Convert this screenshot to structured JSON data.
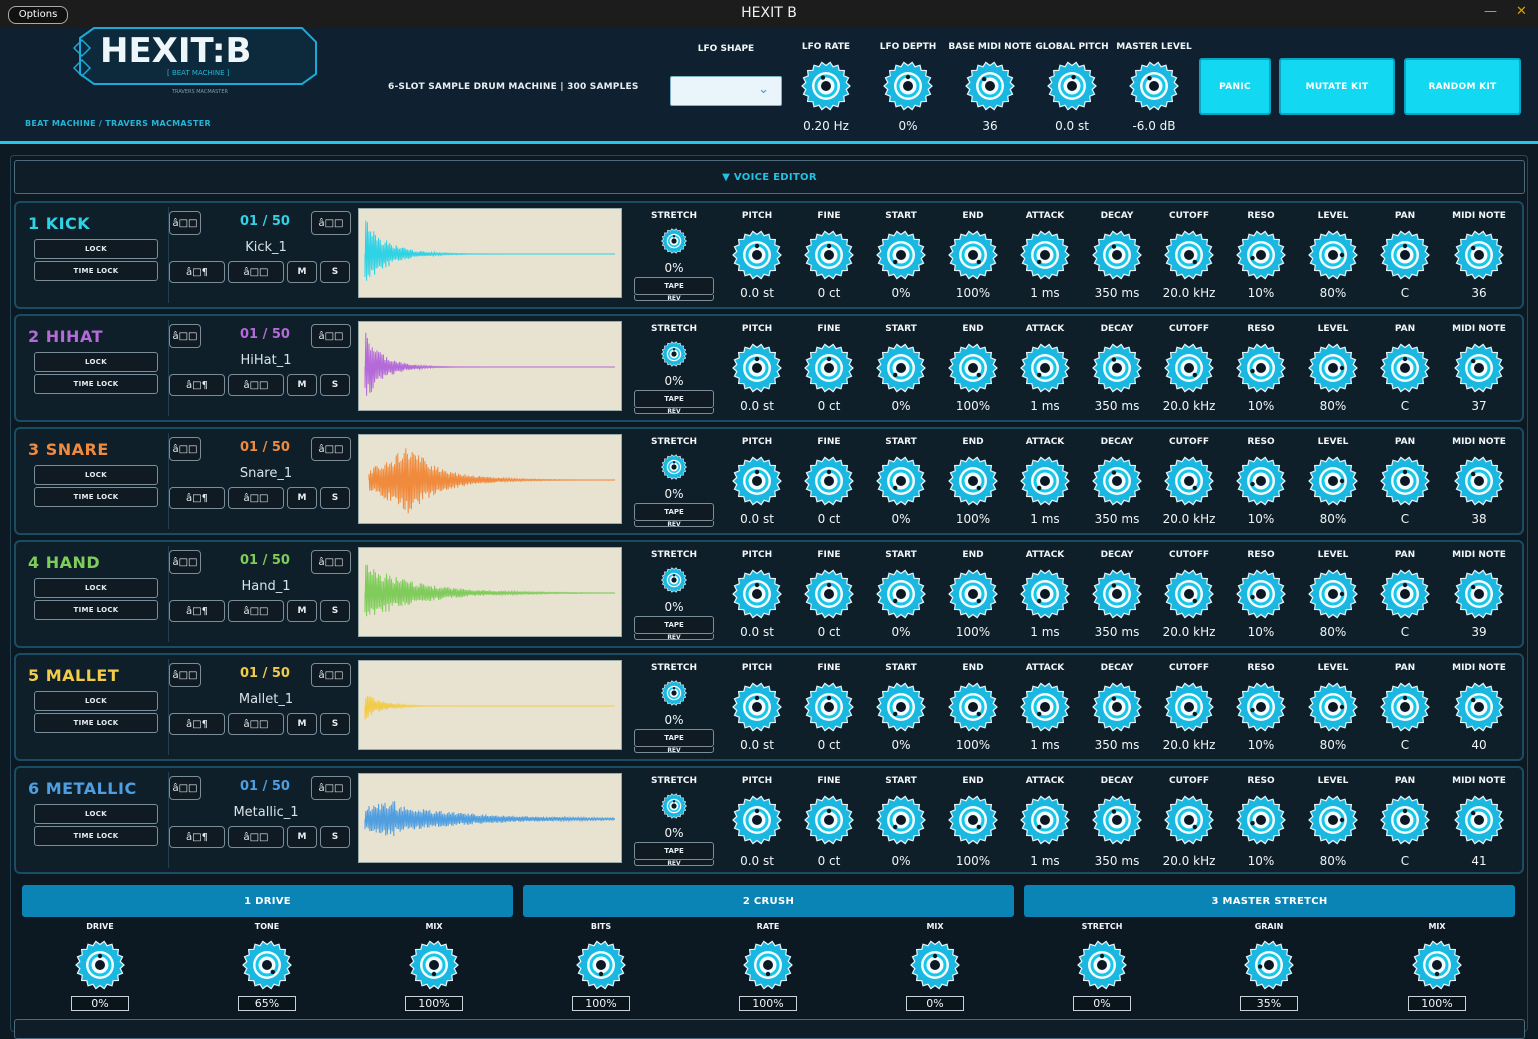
{
  "window": {
    "title": "HEXIT B",
    "options_label": "Options",
    "minimize": "—",
    "close": "✕"
  },
  "logo": {
    "main": "HEXIT:B",
    "tag": "[ BEAT MACHINE ]",
    "credit_small": "TRAVERS MACMASTER",
    "subline": "BEAT MACHINE  /  TRAVERS MACMASTER"
  },
  "tagline": "6-SLOT SAMPLE DRUM MACHINE  |  300 SAMPLES",
  "header_controls": [
    {
      "label": "LFO RATE",
      "value": "0.20 Hz"
    },
    {
      "label": "LFO DEPTH",
      "value": "0%"
    },
    {
      "label": "BASE MIDI NOTE",
      "value": "36"
    },
    {
      "label": "GLOBAL PITCH",
      "value": "0.0 st"
    },
    {
      "label": "MASTER LEVEL",
      "value": "-6.0 dB"
    }
  ],
  "lfo_shape": {
    "label": "LFO SHAPE",
    "value": ""
  },
  "buttons": {
    "panic": "PANIC",
    "mutate": "MUTATE KIT",
    "random": "RANDOM KIT"
  },
  "voice_editor_label": "▼  VOICE EDITOR",
  "voice_common": {
    "lock": "LOCK",
    "time_lock": "TIME LOCK",
    "stretch_label": "STRETCH",
    "stretch_value": "0%",
    "tape": "TAPE",
    "rev": "REV",
    "mute": "M",
    "solo": "S",
    "icon_prev": "â□□",
    "icon_next": "â□□",
    "icon_a": "â□¶",
    "icon_b": "â□□",
    "params": [
      "PITCH",
      "FINE",
      "START",
      "END",
      "ATTACK",
      "DECAY",
      "CUTOFF",
      "RESO",
      "LEVEL",
      "PAN",
      "MIDI NOTE"
    ],
    "param_values": [
      "0.0 st",
      "0 ct",
      "0%",
      "100%",
      "1 ms",
      "350 ms",
      "20.0 kHz",
      "10%",
      "80%",
      "C"
    ]
  },
  "voices": [
    {
      "name": "1  KICK",
      "color": "#2ed3e6",
      "counter": "01 / 50",
      "sample": "Kick_1",
      "midi": "36",
      "wave": "kick"
    },
    {
      "name": "2  HIHAT",
      "color": "#b46ad8",
      "counter": "01 / 50",
      "sample": "HiHat_1",
      "midi": "37",
      "wave": "hihat"
    },
    {
      "name": "3  SNARE",
      "color": "#f08a3c",
      "counter": "01 / 50",
      "sample": "Snare_1",
      "midi": "38",
      "wave": "snare"
    },
    {
      "name": "4  HAND",
      "color": "#7fcc5a",
      "counter": "01 / 50",
      "sample": "Hand_1",
      "midi": "39",
      "wave": "hand"
    },
    {
      "name": "5  MALLET",
      "color": "#f2cc48",
      "counter": "01 / 50",
      "sample": "Mallet_1",
      "midi": "40",
      "wave": "mallet"
    },
    {
      "name": "6  METALLIC",
      "color": "#4f9ee0",
      "counter": "01 / 50",
      "sample": "Metallic_1",
      "midi": "41",
      "wave": "metallic"
    }
  ],
  "fx_tabs": [
    "1  DRIVE",
    "2  CRUSH",
    "3  MASTER STRETCH"
  ],
  "fx_controls": [
    {
      "label": "DRIVE",
      "value": "0%"
    },
    {
      "label": "TONE",
      "value": "65%"
    },
    {
      "label": "MIX",
      "value": "100%"
    },
    {
      "label": "BITS",
      "value": "100%"
    },
    {
      "label": "RATE",
      "value": "100%"
    },
    {
      "label": "MIX",
      "value": "0%"
    },
    {
      "label": "STRETCH",
      "value": "0%"
    },
    {
      "label": "GRAIN",
      "value": "35%"
    },
    {
      "label": "MIX",
      "value": "100%"
    }
  ],
  "colors": {
    "accent": "#12d8f2",
    "knob_teeth": "#1ab7e0",
    "background": "#0d1a24"
  }
}
